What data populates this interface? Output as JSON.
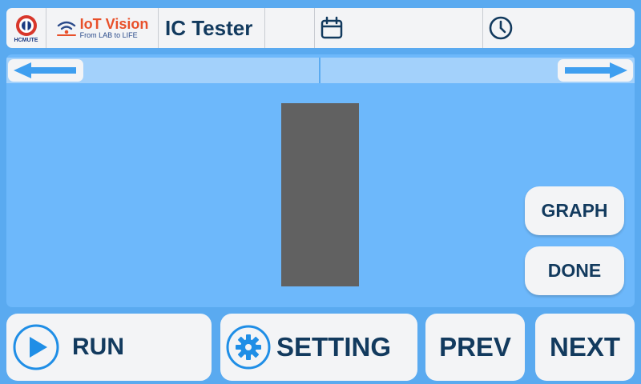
{
  "header": {
    "hcmute_logo_text": "HCMUTE",
    "brand_name": "IoT Vision",
    "brand_tagline": "From LAB to LIFE",
    "app_title": "IC Tester",
    "date_icon": "calendar-icon",
    "time_icon": "clock-icon"
  },
  "nav": {
    "left_icon": "arrow-left-icon",
    "right_icon": "arrow-right-icon"
  },
  "side_buttons": {
    "graph_label": "GRAPH",
    "done_label": "DONE"
  },
  "bottom_buttons": {
    "run_label": "RUN",
    "setting_label": "SETTING",
    "prev_label": "PREV",
    "next_label": "NEXT"
  },
  "colors": {
    "background": "#5aaaf0",
    "panel": "#6db8fb",
    "nav_strip": "#a3d1fb",
    "button": "#f3f4f6",
    "text_dark": "#123a5e",
    "accent_blue": "#1f8ee6",
    "brand_orange": "#e8502a",
    "ic_slot": "#616161"
  }
}
